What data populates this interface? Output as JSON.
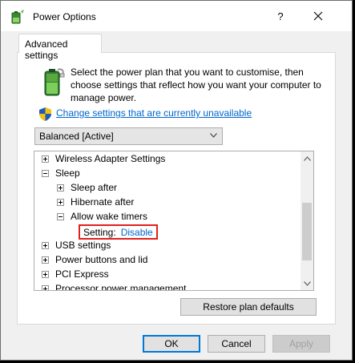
{
  "window": {
    "title": "Power Options",
    "help_label": "?",
    "close_label": "✕"
  },
  "tab": {
    "label": "Advanced settings"
  },
  "description": "Select the power plan that you want to customise, then choose settings that reflect how you want your computer to manage power.",
  "change_link": "Change settings that are currently unavailable",
  "plan_select": {
    "value": "Balanced [Active]"
  },
  "tree": {
    "items": [
      {
        "label": "Wireless Adapter Settings",
        "expander": "+",
        "level": 0
      },
      {
        "label": "Sleep",
        "expander": "−",
        "level": 0
      },
      {
        "label": "Sleep after",
        "expander": "+",
        "level": 1
      },
      {
        "label": "Hibernate after",
        "expander": "+",
        "level": 1
      },
      {
        "label": "Allow wake timers",
        "expander": "−",
        "level": 1
      },
      {
        "label": "USB settings",
        "expander": "+",
        "level": 0
      },
      {
        "label": "Power buttons and lid",
        "expander": "+",
        "level": 0
      },
      {
        "label": "PCI Express",
        "expander": "+",
        "level": 0
      },
      {
        "label": "Processor power management",
        "expander": "+",
        "level": 0
      }
    ],
    "setting": {
      "label": "Setting:",
      "value": "Disable"
    }
  },
  "buttons": {
    "restore": "Restore plan defaults",
    "ok": "OK",
    "cancel": "Cancel",
    "apply": "Apply"
  },
  "colors": {
    "link": "#0066cc",
    "highlight_border": "#e02020",
    "focus_border": "#0078d7"
  }
}
